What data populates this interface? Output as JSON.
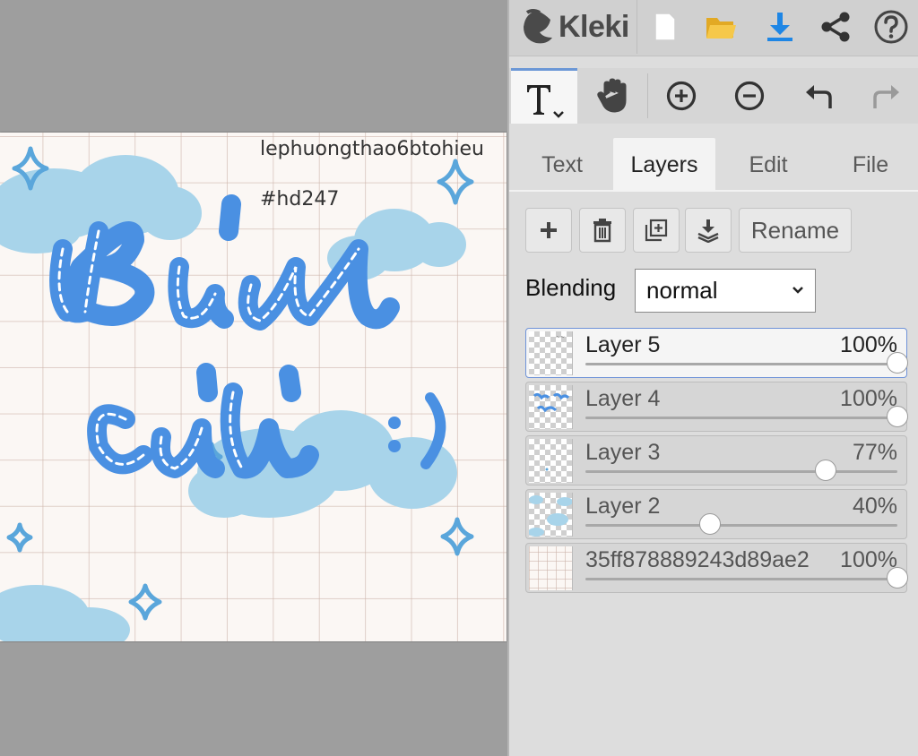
{
  "app": {
    "title": "Kleki"
  },
  "canvas": {
    "texts": [
      "lephuongthao6btohieu",
      "#hd247"
    ]
  },
  "toolbar": {
    "tools": [
      "text-tool",
      "hand-tool",
      "zoom-in",
      "zoom-out",
      "undo",
      "redo"
    ]
  },
  "tabs": [
    {
      "label": "Text"
    },
    {
      "label": "Layers",
      "active": true
    },
    {
      "label": "Edit"
    },
    {
      "label": "File"
    }
  ],
  "layer_actions": {
    "rename_label": "Rename"
  },
  "blending": {
    "label": "Blending",
    "value": "normal"
  },
  "layers": [
    {
      "name": "Layer 5",
      "opacity_label": "100%",
      "opacity": 1.0,
      "selected": true
    },
    {
      "name": "Layer 4",
      "opacity_label": "100%",
      "opacity": 1.0
    },
    {
      "name": "Layer 3",
      "opacity_label": "77%",
      "opacity": 0.77
    },
    {
      "name": "Layer 2",
      "opacity_label": "40%",
      "opacity": 0.4
    },
    {
      "name": "35ff878889243d89ae2",
      "opacity_label": "100%",
      "opacity": 1.0
    }
  ],
  "colors": {
    "accent": "#1e86e5",
    "folder": "#f3c033",
    "selection": "#6f93d8",
    "artwork_blue": "#4a90e2",
    "cloud": "#a8d4ea"
  }
}
